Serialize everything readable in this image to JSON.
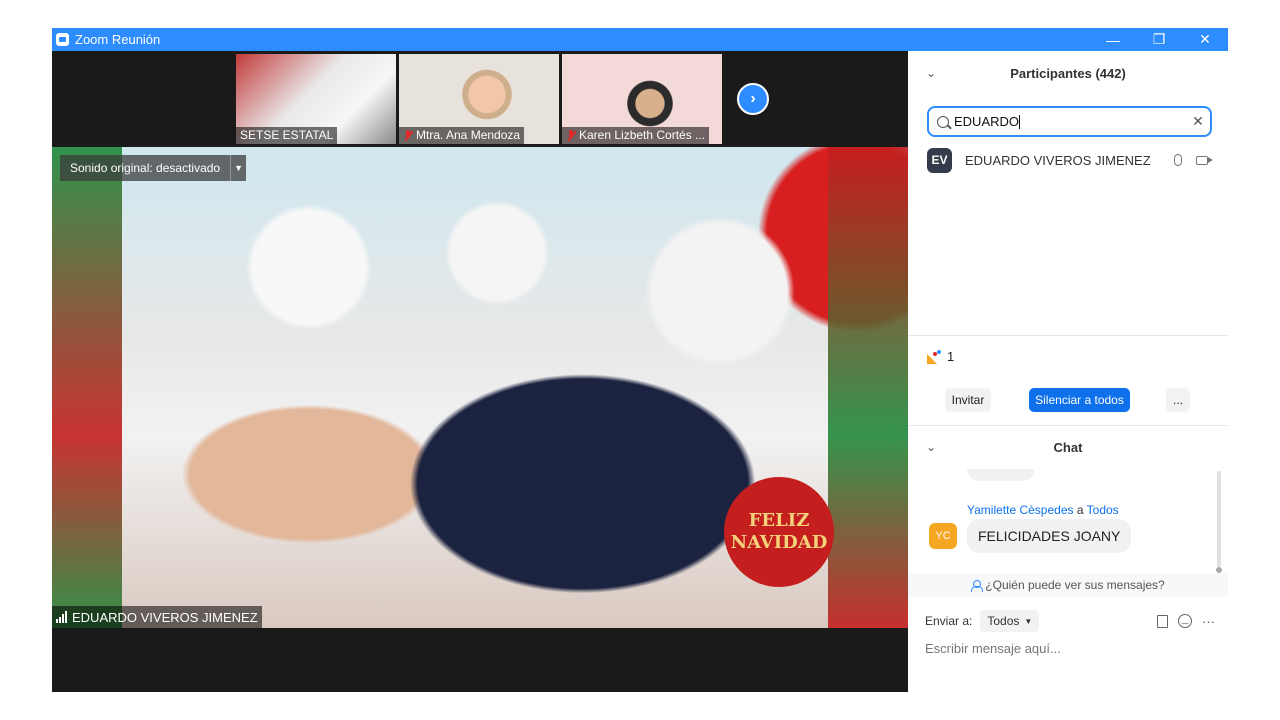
{
  "window": {
    "title": "Zoom Reunión",
    "minimize": "—",
    "restore": "❐",
    "close": "✕"
  },
  "thumbnails": [
    {
      "name": "SETSE ESTATAL",
      "muted": false
    },
    {
      "name": "Mtra. Ana Mendoza",
      "muted": true
    },
    {
      "name": "Karen Lizbeth Cortés ...",
      "muted": true
    }
  ],
  "main_video": {
    "original_sound": "Sonido original: desactivado",
    "speaker": "EDUARDO VIVEROS JIMENEZ",
    "background_text": "FELIZ NAVIDAD"
  },
  "participants": {
    "title": "Participantes (442)",
    "search_value": "EDUARDO",
    "results": [
      {
        "initials": "EV",
        "name": "EDUARDO VIVEROS JIMENEZ"
      }
    ],
    "reaction_count": "1",
    "invite_label": "Invitar",
    "mute_all_label": "Silenciar a todos",
    "more_label": "..."
  },
  "chat": {
    "title": "Chat",
    "messages": [
      {
        "sender": "Yamilette Cèspedes",
        "connector": "a",
        "recipient": "Todos",
        "initials": "YC",
        "text": "FELICIDADES JOANY"
      }
    ],
    "privacy_text": "¿Quién puede ver sus mensajes?",
    "send_to_label": "Enviar a:",
    "send_to_value": "Todos",
    "placeholder": "Escribir mensaje aquí...",
    "more_tools": "···"
  }
}
